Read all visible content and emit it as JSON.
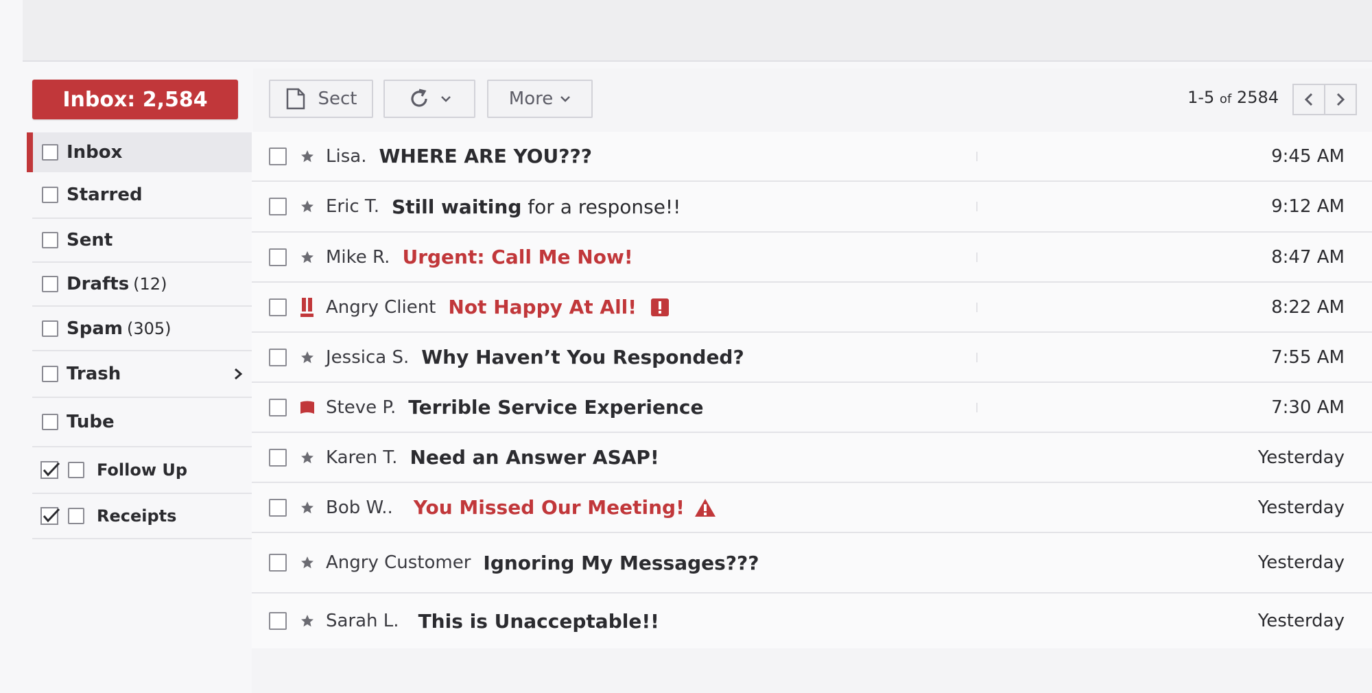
{
  "sidebar": {
    "compose_label": "Inbox: 2,584",
    "items": [
      {
        "label": "Inbox",
        "count": ""
      },
      {
        "label": "Starred",
        "count": ""
      },
      {
        "label": "Sent",
        "count": ""
      },
      {
        "label": "Drafts",
        "count": "(12)"
      },
      {
        "label": "Spam",
        "count": "(305)"
      },
      {
        "label": "Trash",
        "count": ""
      },
      {
        "label": "Tube",
        "count": ""
      },
      {
        "label": "Follow Up",
        "count": ""
      },
      {
        "label": "Receipts",
        "count": ""
      }
    ]
  },
  "toolbar": {
    "select_label": "Sect",
    "more_label": "More",
    "pager_range": "1-5",
    "pager_of": "of",
    "pager_total": "2584"
  },
  "messages": [
    {
      "sender": "Lisa.",
      "subject": "WHERE ARE YOU???",
      "subject_rest": "",
      "time": "9:45 AM"
    },
    {
      "sender": "Eric T.",
      "subject": "Still waiting",
      "subject_rest": " for a response!!",
      "time": "9:12 AM"
    },
    {
      "sender": "Mike R.",
      "subject": "Urgent: Call Me Now!",
      "subject_rest": "",
      "time": "8:47 AM"
    },
    {
      "sender": "Angry Client",
      "subject": "Not Happy At All!",
      "subject_rest": "",
      "time": "8:22 AM"
    },
    {
      "sender": "Jessica S.",
      "subject": "Why Haven’t You Responded?",
      "subject_rest": "",
      "time": "7:55 AM"
    },
    {
      "sender": "Steve P.",
      "subject": "Terrible Service Experience",
      "subject_rest": "",
      "time": "7:30 AM"
    },
    {
      "sender": "Karen T.",
      "subject": "Need an Answer ASAP!",
      "subject_rest": "",
      "time": "Yesterday"
    },
    {
      "sender": "Bob W..",
      "subject": "You Missed Our Meeting!",
      "subject_rest": "",
      "time": "Yesterday"
    },
    {
      "sender": "Angry Customer",
      "subject": "Ignoring My Messages???",
      "subject_rest": "",
      "time": "Yesterday"
    },
    {
      "sender": "Sarah L.",
      "subject": "This is Unacceptable!!",
      "subject_rest": "",
      "time": "Yesterday"
    }
  ],
  "colors": {
    "accent": "#c1373a",
    "text": "#2b2b2f",
    "star": "#6b6b72"
  },
  "icons": {
    "star": "star-icon",
    "important": "important-marker-icon",
    "bookmark": "bookmark-icon",
    "alert_square": "alert-square-icon",
    "warning_triangle": "warning-triangle-icon"
  }
}
